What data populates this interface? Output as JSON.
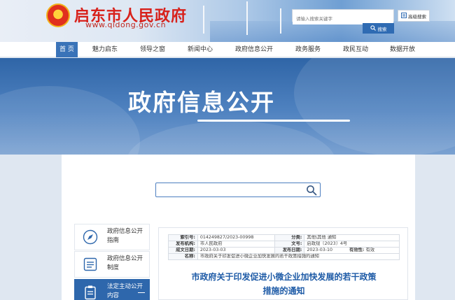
{
  "header": {
    "site_title": "启东市人民政府",
    "site_url": "www.qidong.gov.cn",
    "search_placeholder": "请输入搜索关键字",
    "advanced_search_label": "高级搜索",
    "search_button_label": "搜索",
    "emblem_alt": "national-emblem"
  },
  "nav": {
    "items": [
      {
        "label": "首 页"
      },
      {
        "label": "魅力启东"
      },
      {
        "label": "领导之窗"
      },
      {
        "label": "新闻中心"
      },
      {
        "label": "政府信息公开"
      },
      {
        "label": "政务服务"
      },
      {
        "label": "政民互动"
      },
      {
        "label": "数据开放"
      }
    ],
    "active_index": 0,
    "active_color": "#3a73b8"
  },
  "banner": {
    "title": "政府信息公开"
  },
  "sidebar": {
    "items": [
      {
        "label": "政府信息公开指南",
        "icon": "compass-icon"
      },
      {
        "label": "政府信息公开制度",
        "icon": "list-document-icon"
      },
      {
        "label": "法定主动公开内容",
        "icon": "clipboard-icon"
      }
    ],
    "active_index": 2
  },
  "document": {
    "meta": {
      "index_label": "索引号:",
      "index_value": "014249827/2023-00998",
      "category_label": "分类:",
      "category_value": "其他\\其他   通知",
      "publisher_label": "发布机构:",
      "publisher_value": "市人民政府",
      "doc_no_label": "文号:",
      "doc_no_value": "启政规〔2023〕4号",
      "created_label": "成文日期:",
      "created_value": "2023-03-03",
      "published_label": "发布日期:",
      "published_value": "2023-03-10",
      "validity_label": "有效性:",
      "validity_value": "有效",
      "name_label": "名称:",
      "name_value": "市政府关于印发促进小微企业加快发展的若干政策措施的通知"
    },
    "title_line1": "市政府关于印发促进小微企业加快发展的若干政策",
    "title_line2": "措施的通知"
  },
  "colors": {
    "brand_red": "#d8211b",
    "primary_blue": "#2e67ac",
    "title_blue": "#1d5aa6"
  }
}
